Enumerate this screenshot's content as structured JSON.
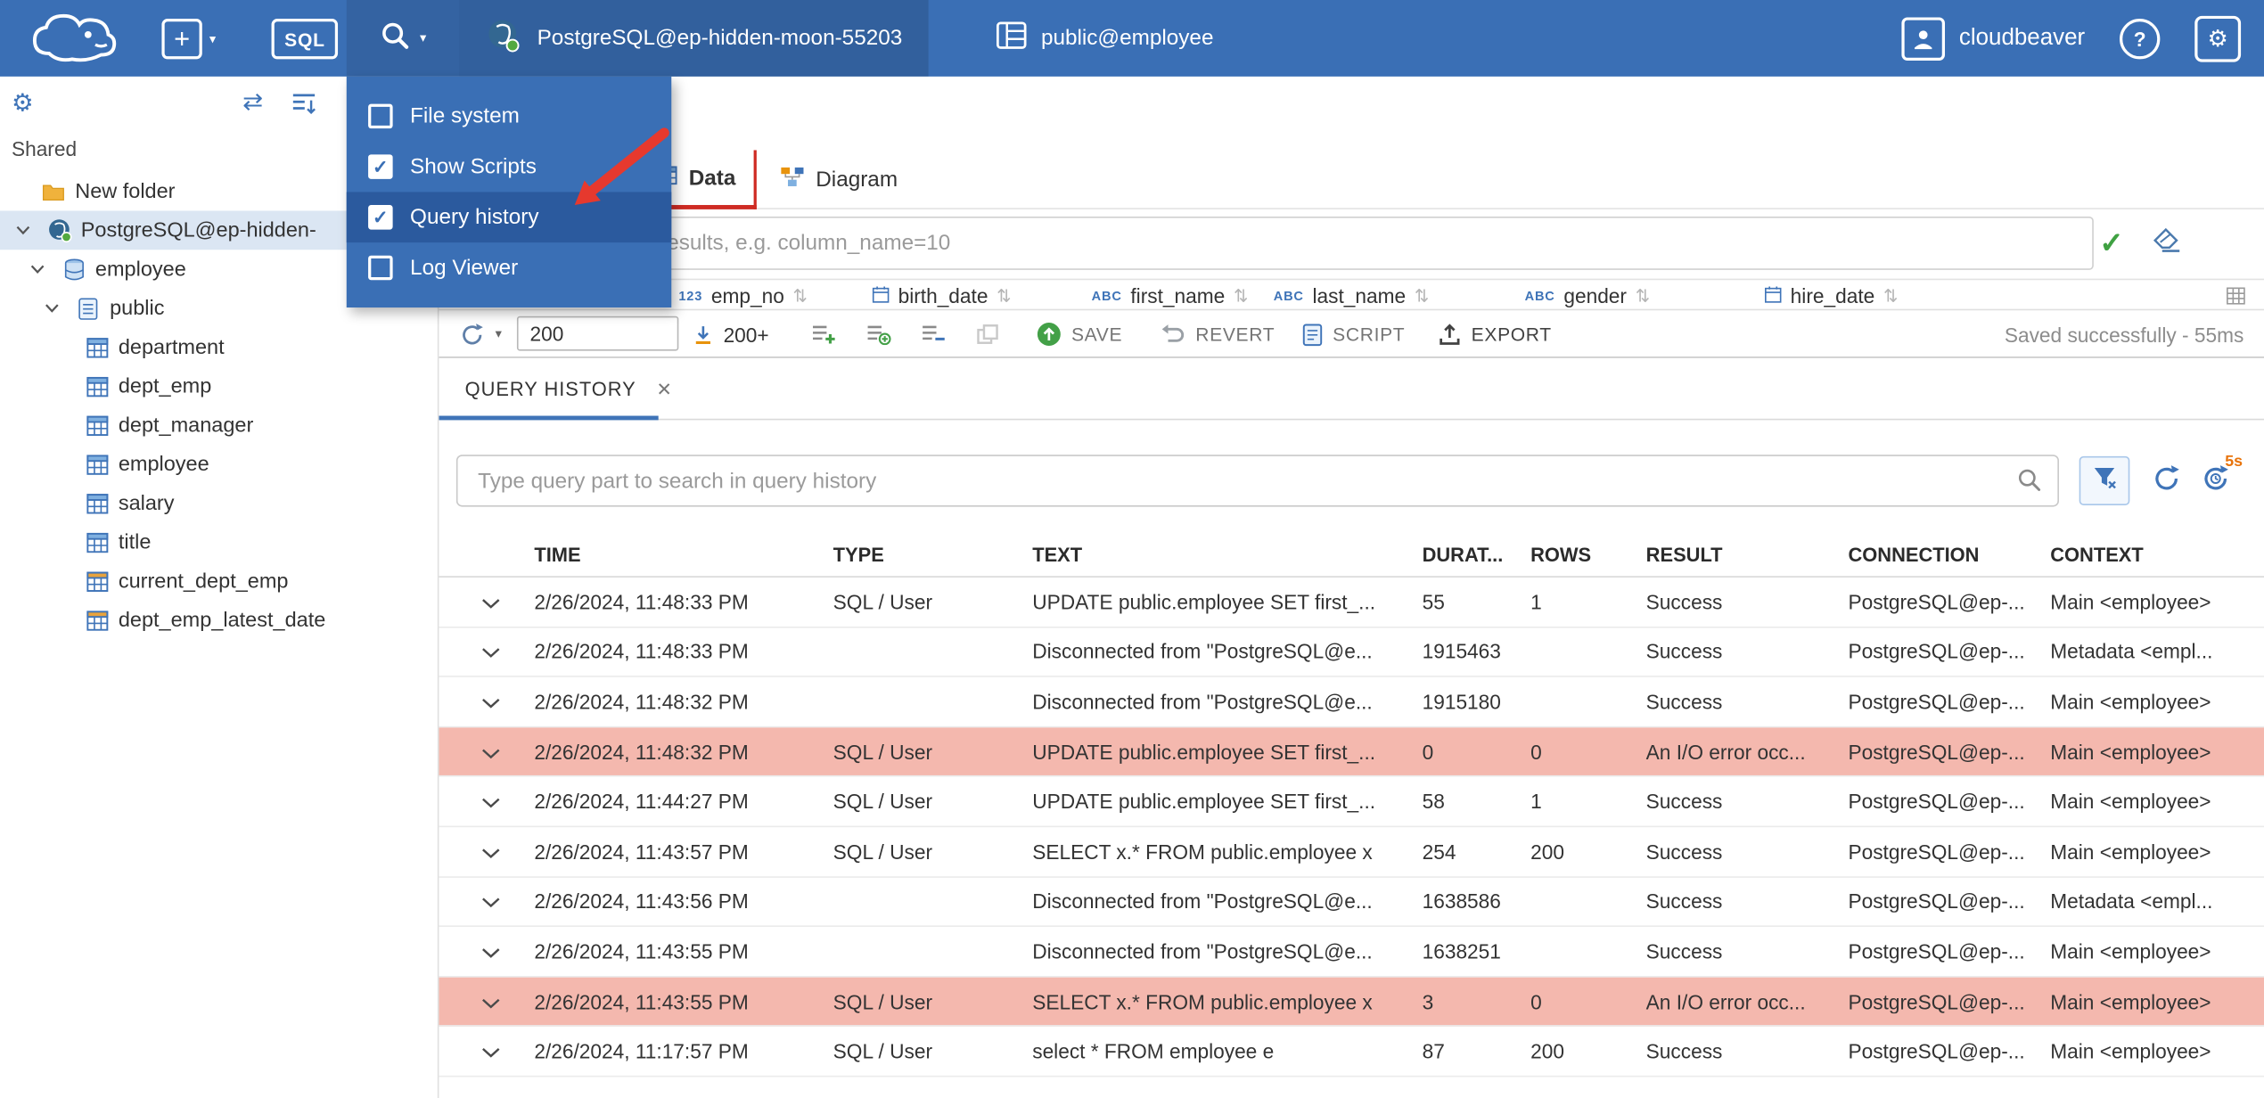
{
  "topbar": {
    "sql_label": "SQL",
    "connection": "PostgreSQL@ep-hidden-moon-55203",
    "schema": "public@employee",
    "user": "cloudbeaver",
    "help_label": "?"
  },
  "view_menu": {
    "items": [
      {
        "label": "File system",
        "checked": false,
        "highlighted": false
      },
      {
        "label": "Show Scripts",
        "checked": true,
        "highlighted": false
      },
      {
        "label": "Query history",
        "checked": true,
        "highlighted": true
      },
      {
        "label": "Log Viewer",
        "checked": false,
        "highlighted": false
      }
    ]
  },
  "sidebar": {
    "section_label": "Shared",
    "tree": [
      {
        "label": "New folder",
        "icon": "folder",
        "indent": 0,
        "chevron": false,
        "selected": false
      },
      {
        "label": "PostgreSQL@ep-hidden-",
        "icon": "postgres",
        "indent": 0,
        "chevron": true,
        "selected": true
      },
      {
        "label": "employee",
        "icon": "database",
        "indent": 1,
        "chevron": true,
        "selected": false
      },
      {
        "label": "public",
        "icon": "schema",
        "indent": 2,
        "chevron": true,
        "selected": false
      },
      {
        "label": "department",
        "icon": "table",
        "indent": 3,
        "chevron": false,
        "selected": false
      },
      {
        "label": "dept_emp",
        "icon": "table",
        "indent": 3,
        "chevron": false,
        "selected": false
      },
      {
        "label": "dept_manager",
        "icon": "table",
        "indent": 3,
        "chevron": false,
        "selected": false
      },
      {
        "label": "employee",
        "icon": "table",
        "indent": 3,
        "chevron": false,
        "selected": false
      },
      {
        "label": "salary",
        "icon": "table",
        "indent": 3,
        "chevron": false,
        "selected": false
      },
      {
        "label": "title",
        "icon": "table",
        "indent": 3,
        "chevron": false,
        "selected": false
      },
      {
        "label": "current_dept_emp",
        "icon": "view",
        "indent": 3,
        "chevron": false,
        "selected": false
      },
      {
        "label": "dept_emp_latest_date",
        "icon": "view",
        "indent": 3,
        "chevron": false,
        "selected": false
      }
    ]
  },
  "main": {
    "tabs": [
      {
        "label": "Data",
        "active": true
      },
      {
        "label": "Diagram",
        "active": false
      }
    ],
    "filter_placeholder": "expression to filter results, e.g. column_name=10",
    "grid_columns": [
      {
        "kind": "number",
        "label": "emp_no"
      },
      {
        "kind": "date",
        "label": "birth_date"
      },
      {
        "kind": "text",
        "label": "first_name"
      },
      {
        "kind": "text",
        "label": "last_name"
      },
      {
        "kind": "text",
        "label": "gender"
      },
      {
        "kind": "date",
        "label": "hire_date"
      }
    ],
    "toolbar": {
      "row_limit": "200",
      "fetch_size_label": "200+",
      "save_label": "SAVE",
      "revert_label": "REVERT",
      "script_label": "SCRIPT",
      "export_label": "EXPORT",
      "status": "Saved successfully - 55ms"
    }
  },
  "query_history": {
    "tab_label": "QUERY HISTORY",
    "search_placeholder": "Type query part to search in query history",
    "auto_refresh_badge": "5s",
    "columns": [
      "TIME",
      "TYPE",
      "TEXT",
      "DURAT...",
      "ROWS",
      "RESULT",
      "CONNECTION",
      "CONTEXT"
    ],
    "rows": [
      {
        "time": "2/26/2024, 11:48:33 PM",
        "type": "SQL / User",
        "text": "UPDATE public.employee SET first_...",
        "duration": "55",
        "rows": "1",
        "result": "Success",
        "connection": "PostgreSQL@ep-...",
        "context": "Main <employee>",
        "error": false
      },
      {
        "time": "2/26/2024, 11:48:33 PM",
        "type": "",
        "text": "Disconnected from \"PostgreSQL@e...",
        "duration": "1915463",
        "rows": "",
        "result": "Success",
        "connection": "PostgreSQL@ep-...",
        "context": "Metadata <empl...",
        "error": false
      },
      {
        "time": "2/26/2024, 11:48:32 PM",
        "type": "",
        "text": "Disconnected from \"PostgreSQL@e...",
        "duration": "1915180",
        "rows": "",
        "result": "Success",
        "connection": "PostgreSQL@ep-...",
        "context": "Main <employee>",
        "error": false
      },
      {
        "time": "2/26/2024, 11:48:32 PM",
        "type": "SQL / User",
        "text": "UPDATE public.employee SET first_...",
        "duration": "0",
        "rows": "0",
        "result": "An I/O error occ...",
        "connection": "PostgreSQL@ep-...",
        "context": "Main <employee>",
        "error": true
      },
      {
        "time": "2/26/2024, 11:44:27 PM",
        "type": "SQL / User",
        "text": "UPDATE public.employee SET first_...",
        "duration": "58",
        "rows": "1",
        "result": "Success",
        "connection": "PostgreSQL@ep-...",
        "context": "Main <employee>",
        "error": false
      },
      {
        "time": "2/26/2024, 11:43:57 PM",
        "type": "SQL / User",
        "text": "SELECT x.* FROM public.employee x",
        "duration": "254",
        "rows": "200",
        "result": "Success",
        "connection": "PostgreSQL@ep-...",
        "context": "Main <employee>",
        "error": false
      },
      {
        "time": "2/26/2024, 11:43:56 PM",
        "type": "",
        "text": "Disconnected from \"PostgreSQL@e...",
        "duration": "1638586",
        "rows": "",
        "result": "Success",
        "connection": "PostgreSQL@ep-...",
        "context": "Metadata <empl...",
        "error": false
      },
      {
        "time": "2/26/2024, 11:43:55 PM",
        "type": "",
        "text": "Disconnected from \"PostgreSQL@e...",
        "duration": "1638251",
        "rows": "",
        "result": "Success",
        "connection": "PostgreSQL@ep-...",
        "context": "Main <employee>",
        "error": false
      },
      {
        "time": "2/26/2024, 11:43:55 PM",
        "type": "SQL / User",
        "text": "SELECT x.* FROM public.employee x",
        "duration": "3",
        "rows": "0",
        "result": "An I/O error occ...",
        "connection": "PostgreSQL@ep-...",
        "context": "Main <employee>",
        "error": true
      },
      {
        "time": "2/26/2024, 11:17:57 PM",
        "type": "SQL / User",
        "text": "select * FROM employee e",
        "duration": "87",
        "rows": "200",
        "result": "Success",
        "connection": "PostgreSQL@ep-...",
        "context": "Main <employee>",
        "error": false
      }
    ]
  },
  "colors": {
    "topbar_blue": "#3a6fb5",
    "menu_highlight": "#2b5a9e",
    "error_row": "#f4b8ae",
    "active_tab_red": "#cf2b23",
    "accent_blue": "#3f74b8",
    "arrow_red": "#e6392e",
    "success_green": "#43a047"
  }
}
